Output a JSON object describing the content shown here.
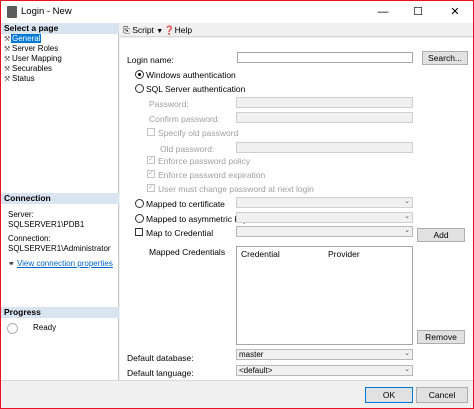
{
  "window": {
    "title": "Login - New",
    "minimize_glyph": "—",
    "maximize_glyph": "☐",
    "close_glyph": "✕",
    "accent_color": "#e81123"
  },
  "left_panel": {
    "select_page_header": "Select a page",
    "pages": [
      {
        "label": "General",
        "selected": true
      },
      {
        "label": "Server Roles",
        "selected": false
      },
      {
        "label": "User Mapping",
        "selected": false
      },
      {
        "label": "Securables",
        "selected": false
      },
      {
        "label": "Status",
        "selected": false
      }
    ],
    "connection_header": "Connection",
    "server_label": "Server:",
    "server_value": "SQLSERVER1\\PDB1",
    "connection_label": "Connection:",
    "connection_value": "SQLSERVER1\\Administrator",
    "view_connection_link": "View connection properties",
    "progress_header": "Progress",
    "progress_status": "Ready"
  },
  "toolbar": {
    "script_label": "Script",
    "help_label": "Help"
  },
  "form": {
    "login_name_label": "Login name:",
    "login_name_value": "",
    "search_button": "Search...",
    "windows_auth_label": "Windows authentication",
    "sql_auth_label": "SQL Server authentication",
    "password_label": "Password:",
    "confirm_password_label": "Confirm password:",
    "specify_old_password_label": "Specify old password",
    "old_password_label": "Old password:",
    "enforce_policy_label": "Enforce password policy",
    "enforce_expiration_label": "Enforce password expiration",
    "must_change_label": "User must change password at next login",
    "mapped_certificate_label": "Mapped to certificate",
    "mapped_asym_key_label": "Mapped to asymmetric key",
    "map_credential_label": "Map to Credential",
    "add_button": "Add",
    "mapped_credentials_label": "Mapped Credentials",
    "credential_column": "Credential",
    "provider_column": "Provider",
    "remove_button": "Remove",
    "default_database_label": "Default database:",
    "default_database_value": "master",
    "default_language_label": "Default language:",
    "default_language_value": "<default>"
  },
  "footer": {
    "ok_button": "OK",
    "cancel_button": "Cancel"
  }
}
